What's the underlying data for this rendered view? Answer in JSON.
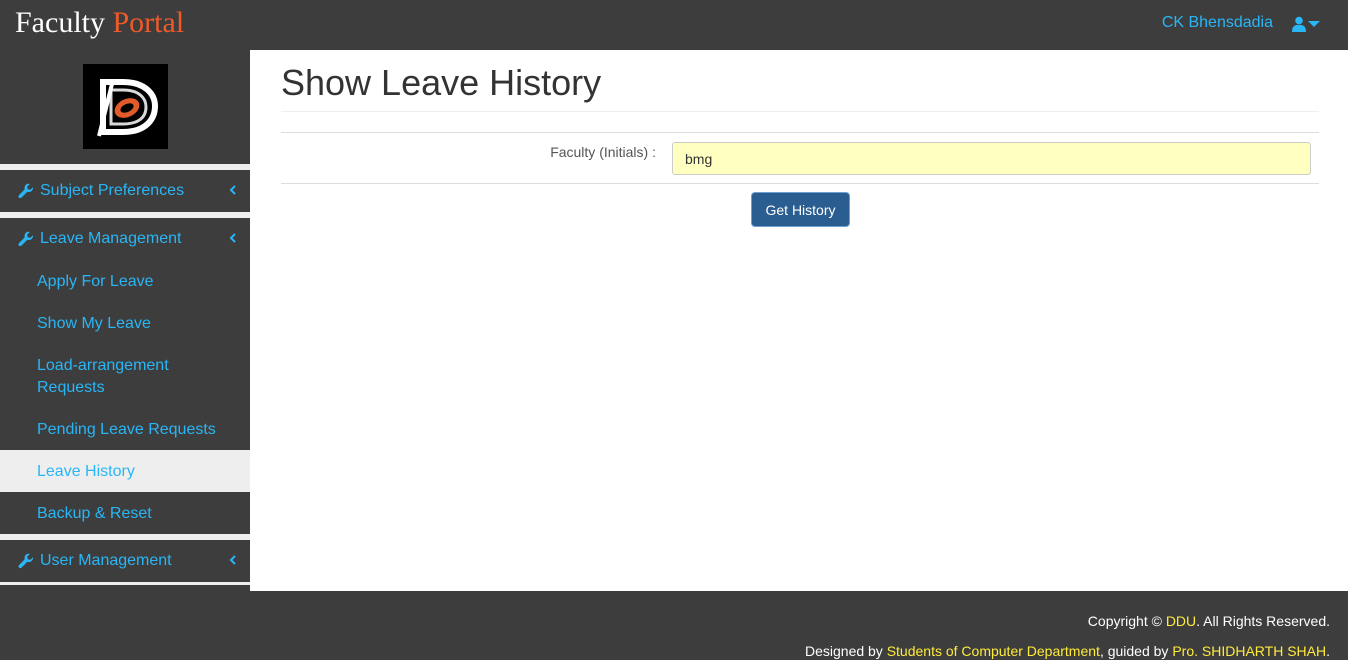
{
  "navbar": {
    "brand_main": "Faculty",
    "brand_accent": "Portal",
    "user_name": "CK Bhensdadia"
  },
  "sidebar": {
    "groups": [
      {
        "label": "Subject Preferences"
      },
      {
        "label": "Leave Management",
        "items": [
          {
            "label": "Apply For Leave"
          },
          {
            "label": "Show My Leave"
          },
          {
            "label": "Load-arrangement Requests"
          },
          {
            "label": "Pending Leave Requests"
          },
          {
            "label": "Leave History",
            "active": true
          },
          {
            "label": "Backup & Reset"
          }
        ]
      },
      {
        "label": "User Management"
      }
    ]
  },
  "main": {
    "title": "Show Leave History",
    "form": {
      "label": "Faculty (Initials) :",
      "value": "bmg",
      "submit_label": "Get History"
    }
  },
  "footer": {
    "copyright_prefix": "Copyright ©",
    "org": "DDU",
    "rights": ". All Rights Reserved.",
    "designed_prefix": "Designed by",
    "designers": "Students of Computer Department",
    "guided": ", guided by",
    "guide": "Pro. SHIDHARTH SHAH",
    "end": "."
  },
  "colors": {
    "bar_bg": "#3d3d3d",
    "link": "#29b6f6",
    "brand_accent": "#f05a28",
    "footer_link": "#ffeb3b",
    "input_bg": "#ffffc0",
    "button_bg": "#2a5d90"
  },
  "icons": [
    "user-icon",
    "caret-down-icon",
    "wrench-icon",
    "chevron-left-icon"
  ]
}
